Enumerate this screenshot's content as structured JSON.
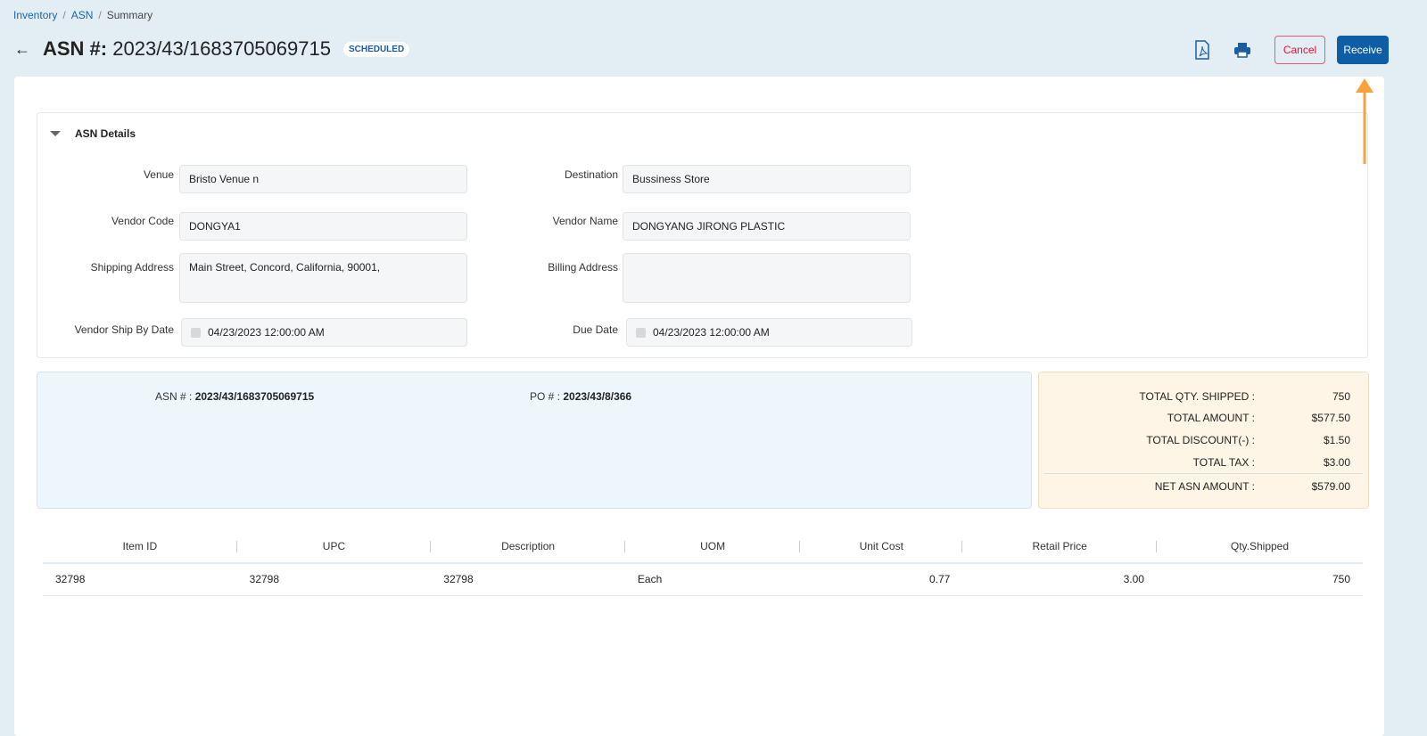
{
  "breadcrumb": [
    "Inventory",
    "ASN",
    "Summary"
  ],
  "header": {
    "title_prefix": "ASN #:",
    "title_value": "2023/43/1683705069715",
    "status": "SCHEDULED",
    "cancel": "Cancel",
    "receive": "Receive"
  },
  "details": {
    "heading": "ASN Details",
    "venue_label": "Venue",
    "venue": "Bristo Venue n",
    "destination_label": "Destination",
    "destination": "Bussiness Store",
    "vendor_code_label": "Vendor Code",
    "vendor_code": "DONGYA1",
    "vendor_name_label": "Vendor Name",
    "vendor_name": "DONGYANG JIRONG PLASTIC",
    "shipping_label": "Shipping Address",
    "shipping": "Main Street, Concord, California, 90001,",
    "billing_label": "Billing Address",
    "billing": "",
    "ship_by_label": "Vendor Ship By Date",
    "ship_by": "04/23/2023 12:00:00 AM",
    "due_label": "Due Date",
    "due": "04/23/2023 12:00:00 AM"
  },
  "info": {
    "asn_label": "ASN # :",
    "asn": "2023/43/1683705069715",
    "po_label": "PO # :",
    "po": "2023/43/8/366"
  },
  "totals": [
    {
      "k": "TOTAL QTY. SHIPPED :",
      "v": "750"
    },
    {
      "k": "TOTAL AMOUNT :",
      "v": "$577.50"
    },
    {
      "k": "TOTAL DISCOUNT(-) :",
      "v": "$1.50"
    },
    {
      "k": "TOTAL TAX :",
      "v": "$3.00"
    },
    {
      "k": "NET ASN AMOUNT :",
      "v": "$579.00"
    }
  ],
  "table": {
    "headers": [
      "Item ID",
      "UPC",
      "Description",
      "UOM",
      "Unit Cost",
      "Retail Price",
      "Qty.Shipped"
    ],
    "rows": [
      [
        "32798",
        "32798",
        "32798",
        "Each",
        "0.77",
        "3.00",
        "750"
      ]
    ]
  },
  "colors": {
    "primary": "#0f5da5",
    "danger": "#e3123a",
    "annotation": "#f9a23c"
  }
}
